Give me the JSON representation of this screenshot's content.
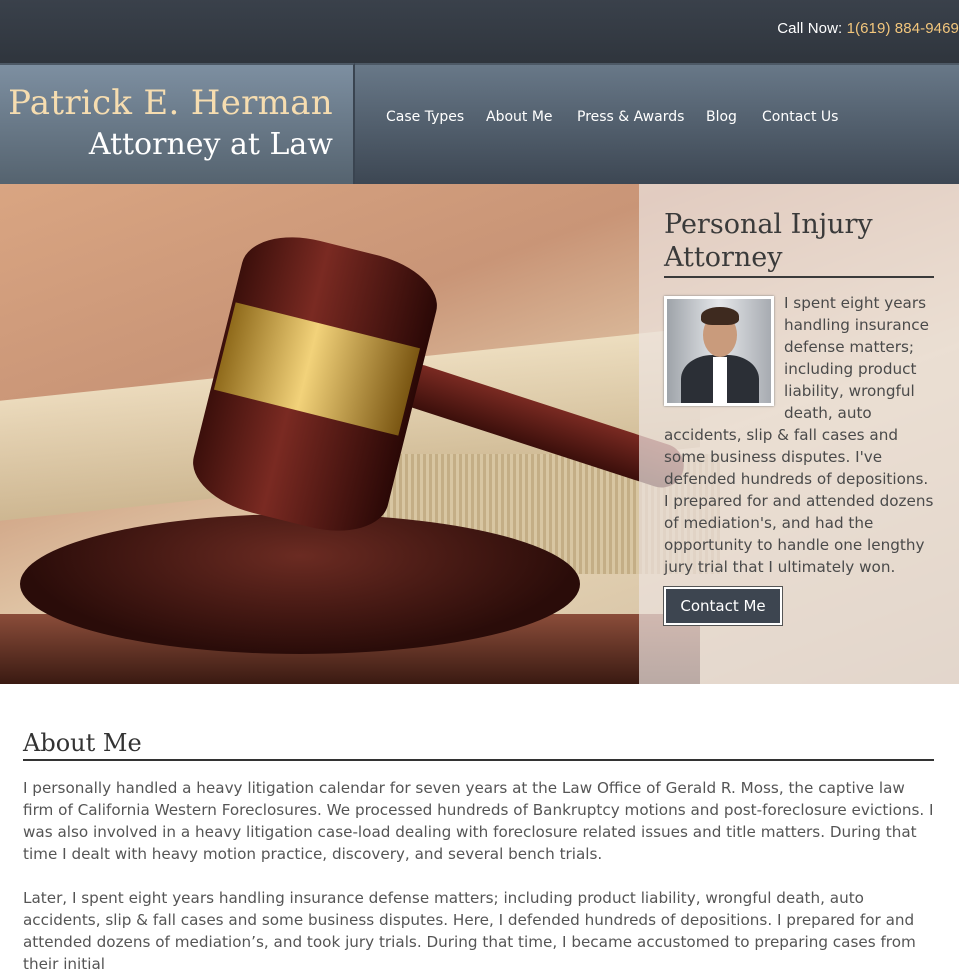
{
  "topbar": {
    "call_label": "Call Now: ",
    "phone": "1(619) 884-9469"
  },
  "brand": {
    "name": "Patrick E. Herman",
    "subtitle": "Attorney at Law"
  },
  "nav": {
    "items": [
      {
        "label": "Case Types"
      },
      {
        "label": "About Me"
      },
      {
        "label": "Press & Awards"
      },
      {
        "label": "Blog"
      },
      {
        "label": "Contact Us"
      }
    ]
  },
  "hero": {
    "title": "Personal Injury Attorney",
    "body": "I spent eight years handling insurance defense matters; including product liability, wrongful death, auto accidents, slip & fall cases and some business disputes. I've defended hundreds of depositions. I prepared for and attended dozens of mediation's, and had the opportunity to handle one lengthy jury trial that I ultimately won.",
    "button": "Contact Me"
  },
  "about": {
    "title": "About Me",
    "p1": "I personally handled a heavy litigation calendar for seven years at the Law Office of Gerald R. Moss, the captive law firm of California Western Foreclosures. We processed hundreds of Bankruptcy motions and post-foreclosure evictions. I was also involved in a heavy litigation case-load dealing with foreclosure related issues and title matters. During that time I dealt with heavy motion practice, discovery, and several bench trials.",
    "p2": "Later, I spent eight years handling insurance defense matters; including product liability, wrongful death, auto accidents, slip & fall cases and some business disputes. Here, I defended hundreds of depositions. I prepared for and attended dozens of mediation’s, and took jury trials. During that time, I became accustomed to preparing cases from their initial"
  },
  "colors": {
    "accent_gold": "#f2c67c",
    "header_slate": "#4b5866",
    "button": "#3d4550"
  }
}
